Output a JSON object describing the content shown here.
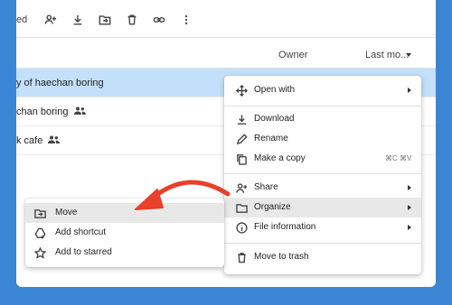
{
  "toolbar": {
    "share_text": "ed",
    "icons": [
      "add-person-icon",
      "download-icon",
      "move-to-folder-icon",
      "trash-icon",
      "link-icon",
      "more-vert-icon"
    ]
  },
  "columns": {
    "owner": "Owner",
    "last_modified": "Last mo..."
  },
  "files": [
    {
      "name": "y of haechan boring",
      "shared": false,
      "selected": true
    },
    {
      "name": "chan boring",
      "shared": true,
      "selected": false
    },
    {
      "name": "k cafe",
      "shared": true,
      "selected": false
    }
  ],
  "context_menu": {
    "open_with": "Open with",
    "download": "Download",
    "rename": "Rename",
    "make_copy": "Make a copy",
    "make_copy_shortcut": "⌘C ⌘V",
    "share": "Share",
    "organize": "Organize",
    "file_information": "File information",
    "move_to_trash": "Move to trash"
  },
  "organize_submenu": {
    "move": "Move",
    "add_shortcut": "Add shortcut",
    "add_to_starred": "Add to starred"
  },
  "colors": {
    "background": "#3b86d4",
    "selection": "#c2e0f9",
    "highlight": "#e8e8e8",
    "arrow": "#e8402a"
  }
}
